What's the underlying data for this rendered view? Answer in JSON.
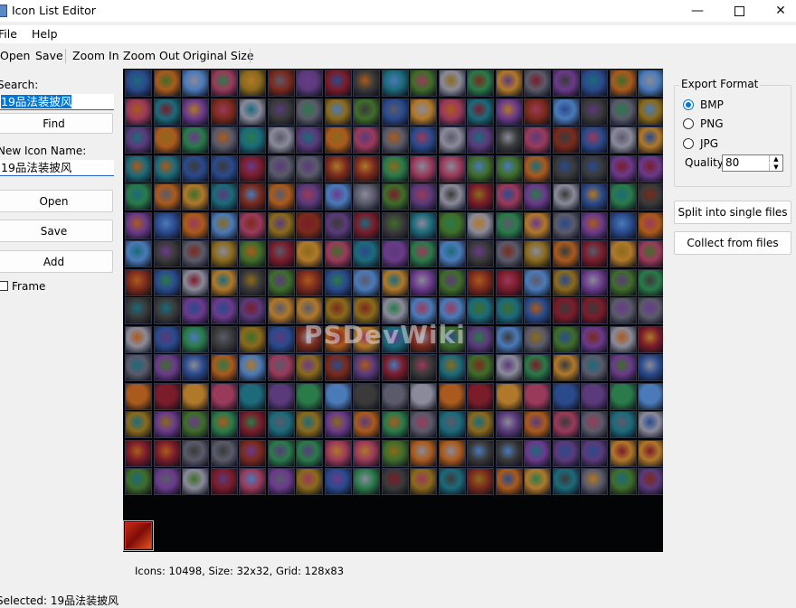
{
  "window": {
    "title": "Icon List Editor"
  },
  "menu": {
    "items": [
      "File",
      "Help"
    ]
  },
  "toolbar": {
    "open": "Open",
    "save": "Save",
    "zoom_in": "Zoom In",
    "zoom_out": "Zoom Out",
    "original_size": "Original Size"
  },
  "left_panel": {
    "search_label": "Search:",
    "search_value": "19品法装披风",
    "find_button": "Find",
    "new_name_label": "New Icon Name:",
    "new_name_value": "19品法装披风",
    "open_button": "Open",
    "save_button": "Save",
    "add_button": "Add",
    "frame_label": "Frame",
    "frame_checked": false
  },
  "grid": {
    "status": "Icons: 10498, Size: 32x32, Grid: 128x83",
    "watermark": "PSDevWiki",
    "palette": [
      "#2a4a8c",
      "#7a2a1c",
      "#3f6d2a",
      "#6a3a8a",
      "#8a6a1c",
      "#1c6a7a",
      "#5a5a6a",
      "#9a3a5a",
      "#3a3a3a",
      "#b0782a",
      "#4a7ab8",
      "#7a1c2a",
      "#2a7a4a",
      "#aa5a1c",
      "#5a3a7a",
      "#8a8a9a"
    ]
  },
  "right_panel": {
    "export_group": "Export Format",
    "formats": [
      {
        "label": "BMP",
        "selected": true
      },
      {
        "label": "PNG",
        "selected": false
      },
      {
        "label": "JPG",
        "selected": false
      }
    ],
    "quality_label": "Quality:",
    "quality_value": "80",
    "split_button": "Split into single files",
    "collect_button": "Collect from files"
  },
  "statusbar": {
    "selected_text": "Selected: 19品法装披风"
  }
}
